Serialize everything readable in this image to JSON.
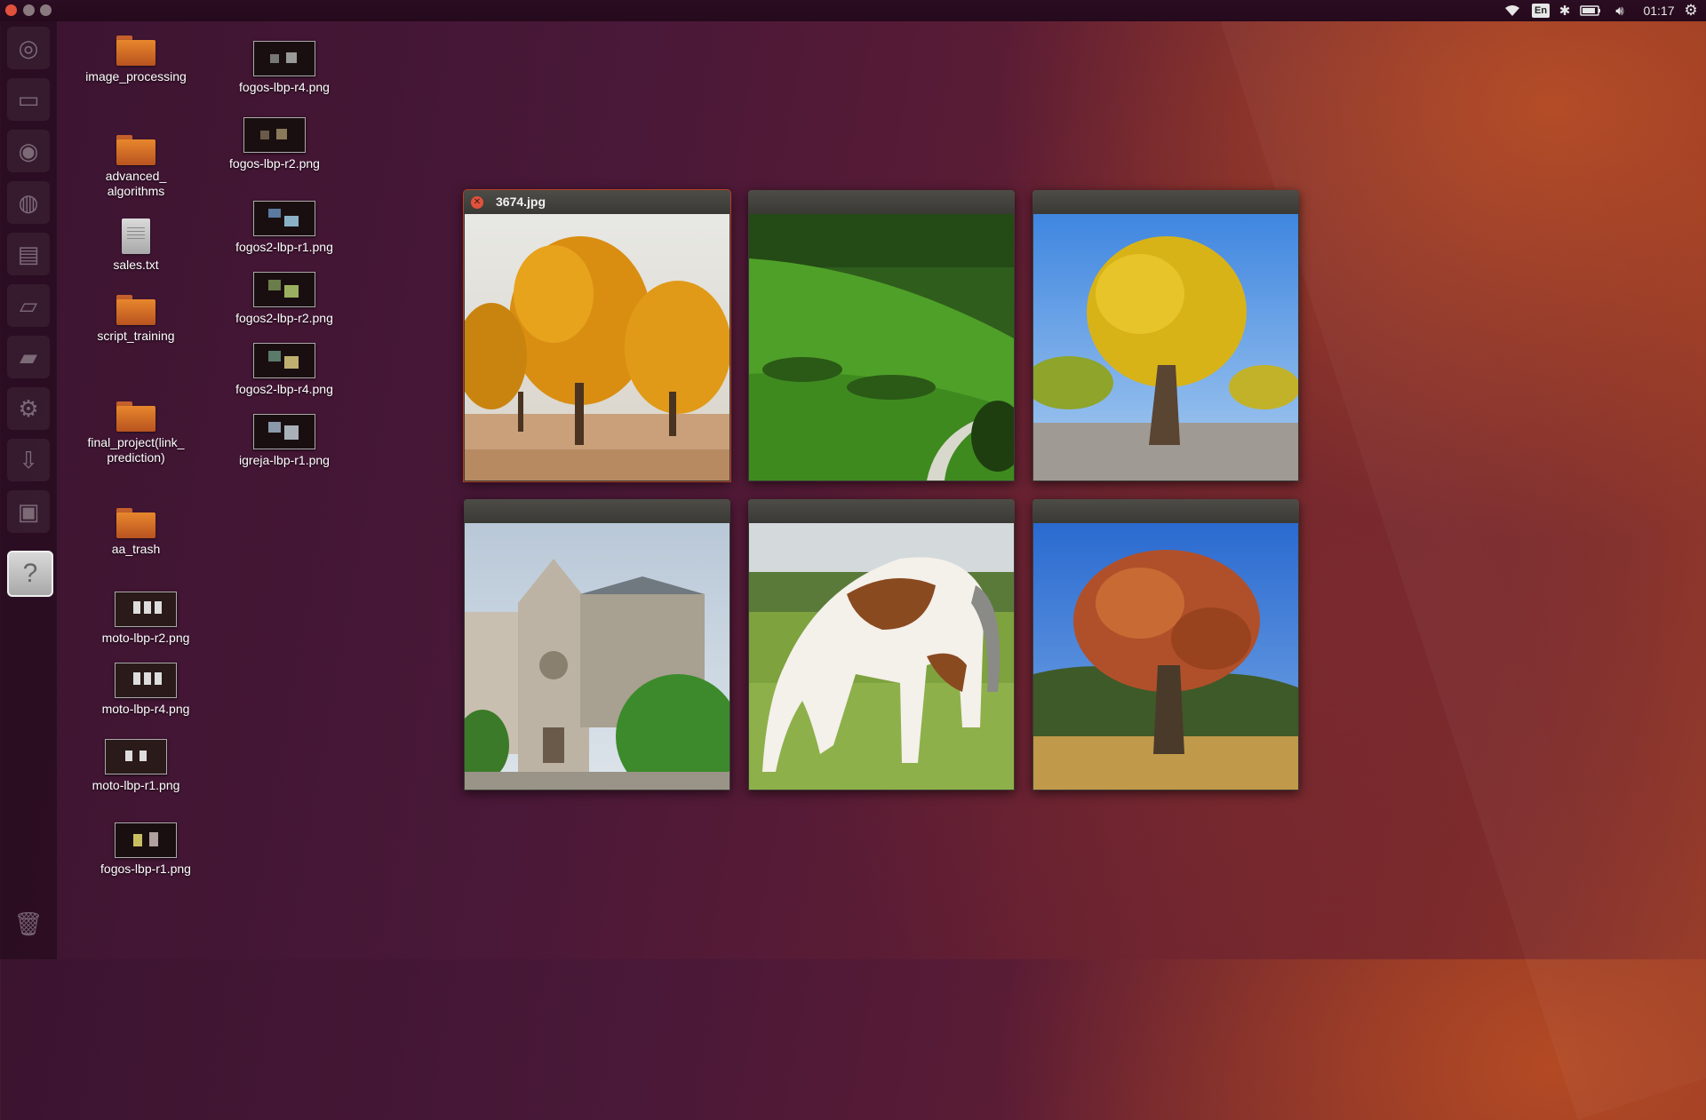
{
  "window_controls": {
    "close": "close",
    "minimize": "minimize",
    "maximize": "maximize"
  },
  "panel": {
    "keyboard_layout": "En",
    "clock": "01:17",
    "indicators": [
      "wifi-icon",
      "keyboard-icon",
      "bluetooth-icon",
      "battery-icon",
      "volume-icon",
      "session-gear-icon"
    ]
  },
  "launcher": {
    "items": [
      "ubuntu-dash",
      "files",
      "chromium",
      "firefox",
      "libreoffice-writer",
      "libreoffice-impress",
      "system-settings",
      "software-updater",
      "image-viewer",
      "help"
    ],
    "help_glyph": "?"
  },
  "desktop": {
    "col1": [
      {
        "label": "image_processing",
        "kind": "folder"
      },
      {
        "label": "advanced_\nalgorithms",
        "kind": "folder"
      },
      {
        "label": "sales.txt",
        "kind": "text"
      },
      {
        "label": "script_training",
        "kind": "folder"
      },
      {
        "label": "final_project(link_\nprediction)",
        "kind": "folder"
      },
      {
        "label": "aa_trash",
        "kind": "folder"
      },
      {
        "label": "moto-lbp-r2.png",
        "kind": "image"
      },
      {
        "label": "moto-lbp-r4.png",
        "kind": "image"
      },
      {
        "label": "moto-lbp-r1.png",
        "kind": "image"
      },
      {
        "label": "fogos-lbp-r1.png",
        "kind": "image"
      }
    ],
    "col2": [
      {
        "label": "fogos-lbp-r4.png",
        "kind": "image"
      },
      {
        "label": "fogos-lbp-r2.png",
        "kind": "image"
      },
      {
        "label": "fogos2-lbp-r1.png",
        "kind": "image"
      },
      {
        "label": "fogos2-lbp-r2.png",
        "kind": "image"
      },
      {
        "label": "fogos2-lbp-r4.png",
        "kind": "image"
      },
      {
        "label": "igreja-lbp-r1.png",
        "kind": "image"
      }
    ]
  },
  "spread": {
    "windows": [
      {
        "title": "3674.jpg",
        "active": true,
        "image": "golden-poplar-trees"
      },
      {
        "title": "",
        "active": false,
        "image": "green-hillside-with-path"
      },
      {
        "title": "",
        "active": false,
        "image": "yellow-tree-blue-sky"
      },
      {
        "title": "",
        "active": false,
        "image": "gothic-church"
      },
      {
        "title": "",
        "active": false,
        "image": "grazing-paint-horse"
      },
      {
        "title": "",
        "active": false,
        "image": "autumn-oak-tree"
      }
    ],
    "close_glyph": "✕"
  }
}
